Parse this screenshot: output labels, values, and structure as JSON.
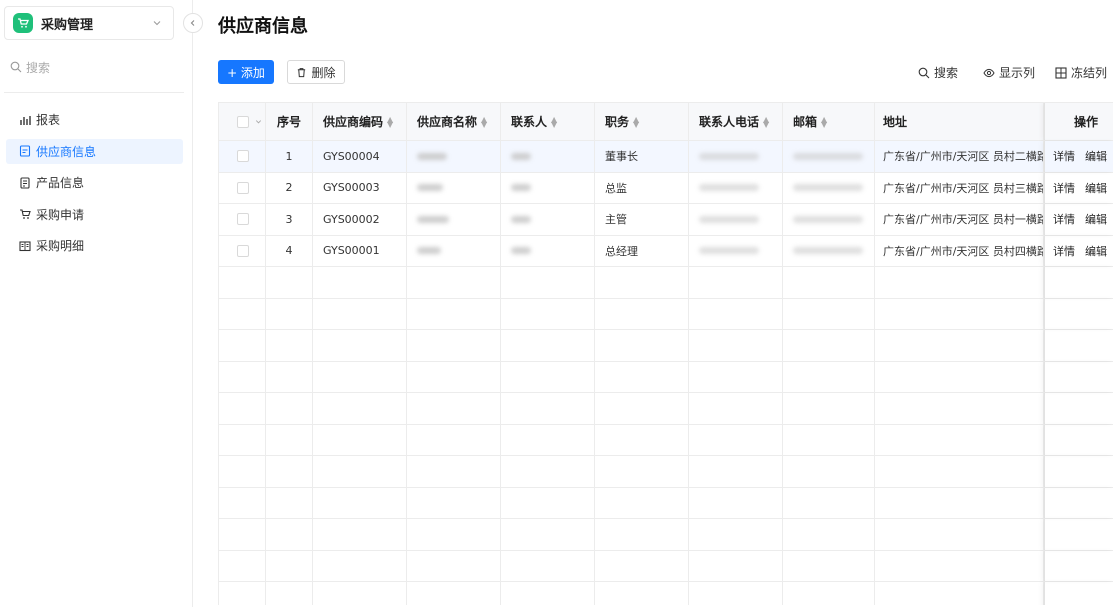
{
  "sidebar": {
    "app_title": "采购管理",
    "search_placeholder": "搜索",
    "items": [
      {
        "label": "报表",
        "icon": "bar-chart-icon",
        "active": false
      },
      {
        "label": "供应商信息",
        "icon": "document-icon",
        "active": true
      },
      {
        "label": "产品信息",
        "icon": "file-list-icon",
        "active": false
      },
      {
        "label": "采购申请",
        "icon": "cart-icon",
        "active": false
      },
      {
        "label": "采购明细",
        "icon": "book-icon",
        "active": false
      }
    ]
  },
  "page": {
    "title": "供应商信息"
  },
  "toolbar": {
    "add_label": "+ 添加",
    "delete_label": "删除",
    "search_label": "搜索",
    "columns_label": "显示列",
    "freeze_label": "冻结列"
  },
  "table": {
    "headers": {
      "seq": "序号",
      "code": "供应商编码",
      "name": "供应商名称",
      "contact": "联系人",
      "position": "职务",
      "phone": "联系人电话",
      "email": "邮箱",
      "address": "地址",
      "ops": "操作"
    },
    "rows": [
      {
        "seq": "1",
        "code": "GYS00004",
        "position": "董事长",
        "address": "广东省/广州市/天河区 员村二横路",
        "detail": "详情",
        "edit": "编辑"
      },
      {
        "seq": "2",
        "code": "GYS00003",
        "position": "总监",
        "address": "广东省/广州市/天河区 员村三横路",
        "detail": "详情",
        "edit": "编辑"
      },
      {
        "seq": "3",
        "code": "GYS00002",
        "position": "主管",
        "address": "广东省/广州市/天河区 员村一横路",
        "detail": "详情",
        "edit": "编辑"
      },
      {
        "seq": "4",
        "code": "GYS00001",
        "position": "总经理",
        "address": "广东省/广州市/天河区 员村四横路",
        "detail": "详情",
        "edit": "编辑"
      }
    ]
  },
  "colors": {
    "accent": "#1677ff",
    "logo": "#1fc07a",
    "active_bg": "#edf4ff"
  }
}
